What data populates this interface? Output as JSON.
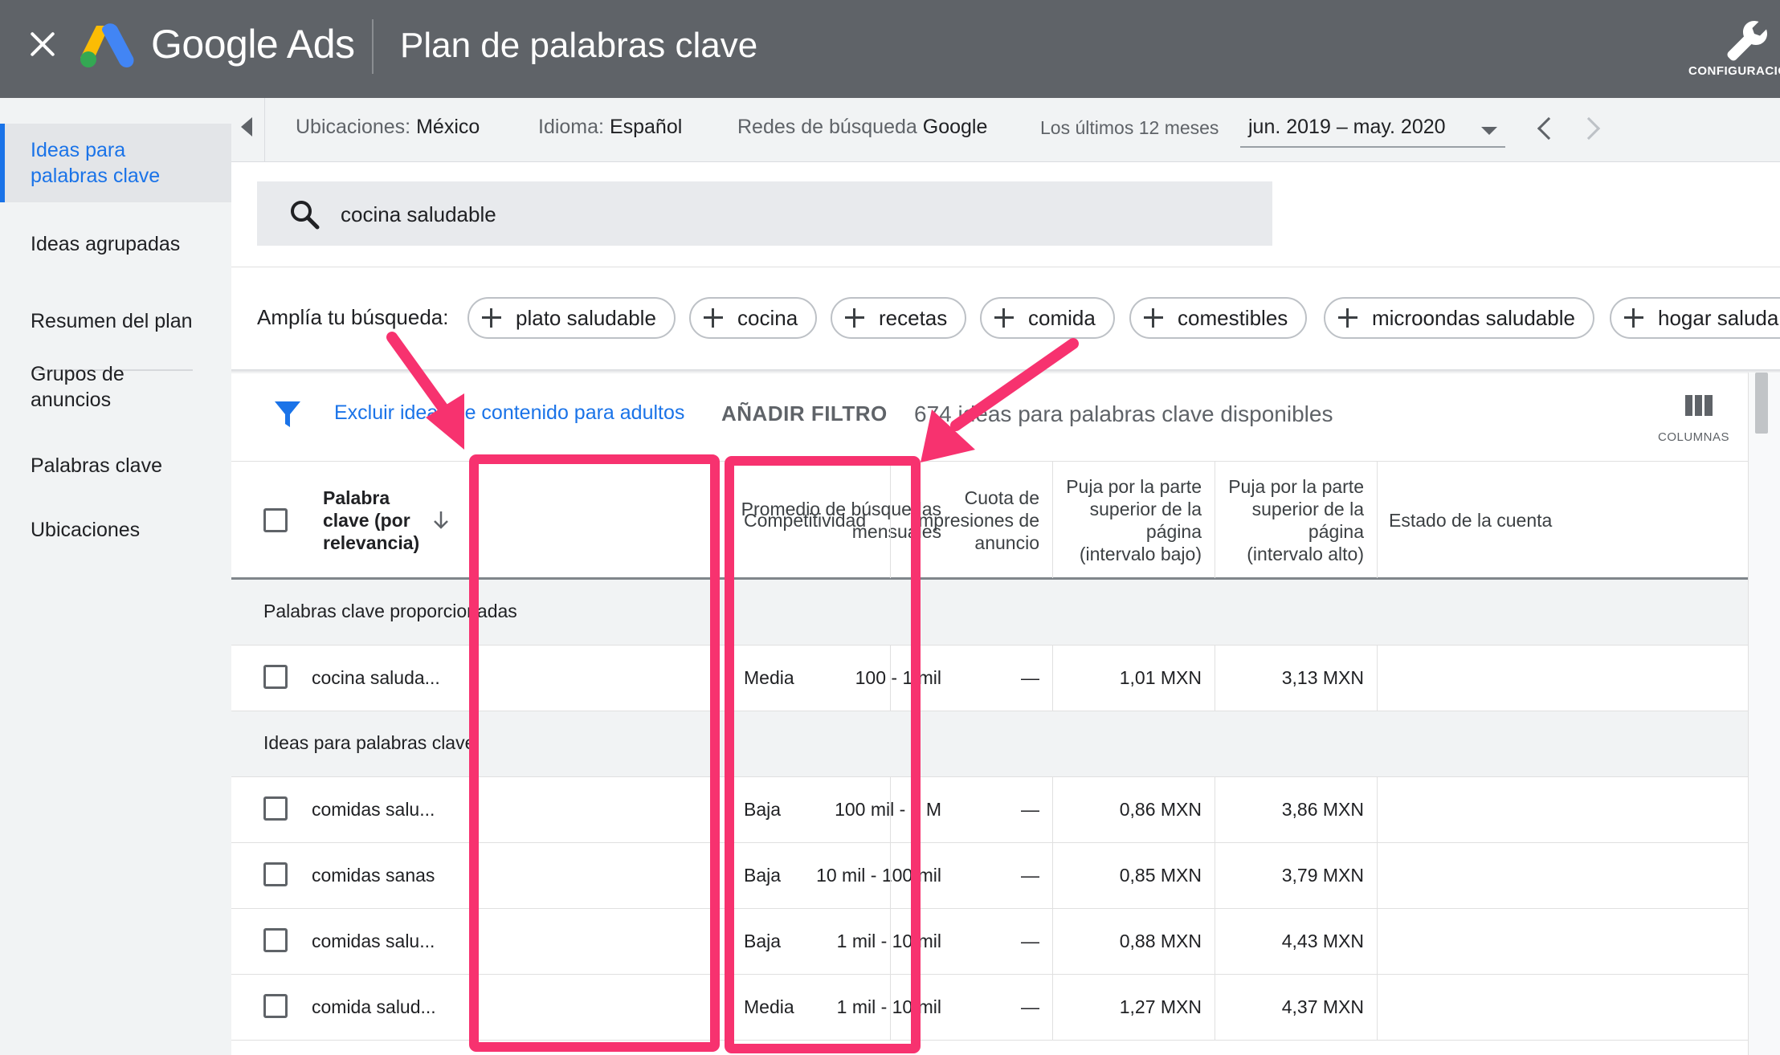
{
  "topbar": {
    "brand": "Google Ads",
    "title": "Plan de palabras clave",
    "tool_label": "CONFIGURACIÓN",
    "close_icon": "close-icon",
    "tool_icon": "wrench-icon"
  },
  "sidebar": {
    "items": [
      {
        "label": "Ideas para palabras clave",
        "active": true
      },
      {
        "label": "Ideas agrupadas"
      },
      {
        "label": "Resumen del plan"
      },
      {
        "label": "Grupos de anuncios"
      },
      {
        "label": "Palabras clave"
      },
      {
        "label": "Ubicaciones"
      }
    ]
  },
  "filters": {
    "location_label": "Ubicaciones:",
    "location_value": "México",
    "language_label": "Idioma:",
    "language_value": "Español",
    "network_label": "Redes de búsqueda",
    "network_value": "Google",
    "period_label": "Los últimos 12 meses",
    "period_value": "jun. 2019 – may. 2020"
  },
  "search": {
    "query": "cocina saludable"
  },
  "expand": {
    "label": "Amplía tu búsqueda:",
    "chips": [
      "plato saludable",
      "cocina",
      "recetas",
      "comida",
      "comestibles",
      "microondas saludable",
      "hogar saludable"
    ]
  },
  "toolbar": {
    "exclude_link": "Excluir ideas de contenido para adultos",
    "add_filter": "AÑADIR FILTRO",
    "count_text": "674 ideas para palabras clave disponibles",
    "columns_label": "COLUMNAS"
  },
  "table": {
    "headers": {
      "keyword": "Palabra clave (por relevancia)",
      "avg_searches": "Promedio de búsquedas mensuales",
      "competition": "Competitividad",
      "impression_share": "Cuota de impresiones de anuncio",
      "bid_low": "Puja por la parte superior de la página (intervalo bajo)",
      "bid_high": "Puja por la parte superior de la página (intervalo alto)",
      "account_status": "Estado de la cuenta"
    },
    "sections": [
      {
        "title": "Palabras clave proporcionadas",
        "rows": [
          {
            "keyword": "cocina saluda...",
            "avg": "100 - 1 mil",
            "competition": "Media",
            "share": "—",
            "low": "1,01 MXN",
            "high": "3,13 MXN"
          }
        ]
      },
      {
        "title": "Ideas para palabras clave",
        "rows": [
          {
            "keyword": "comidas salu...",
            "avg": "100 mil - 1 M",
            "competition": "Baja",
            "share": "—",
            "low": "0,86 MXN",
            "high": "3,86 MXN"
          },
          {
            "keyword": "comidas sanas",
            "avg": "10 mil - 100 mil",
            "competition": "Baja",
            "share": "—",
            "low": "0,85 MXN",
            "high": "3,79 MXN"
          },
          {
            "keyword": "comidas salu...",
            "avg": "1 mil - 10 mil",
            "competition": "Baja",
            "share": "—",
            "low": "0,88 MXN",
            "high": "4,43 MXN"
          },
          {
            "keyword": "comida salud...",
            "avg": "1 mil - 10 mil",
            "competition": "Media",
            "share": "—",
            "low": "1,27 MXN",
            "high": "4,37 MXN"
          }
        ]
      }
    ]
  },
  "colors": {
    "topbar": "#5f6368",
    "accent": "#1a73e8",
    "highlight": "#f7326f"
  }
}
